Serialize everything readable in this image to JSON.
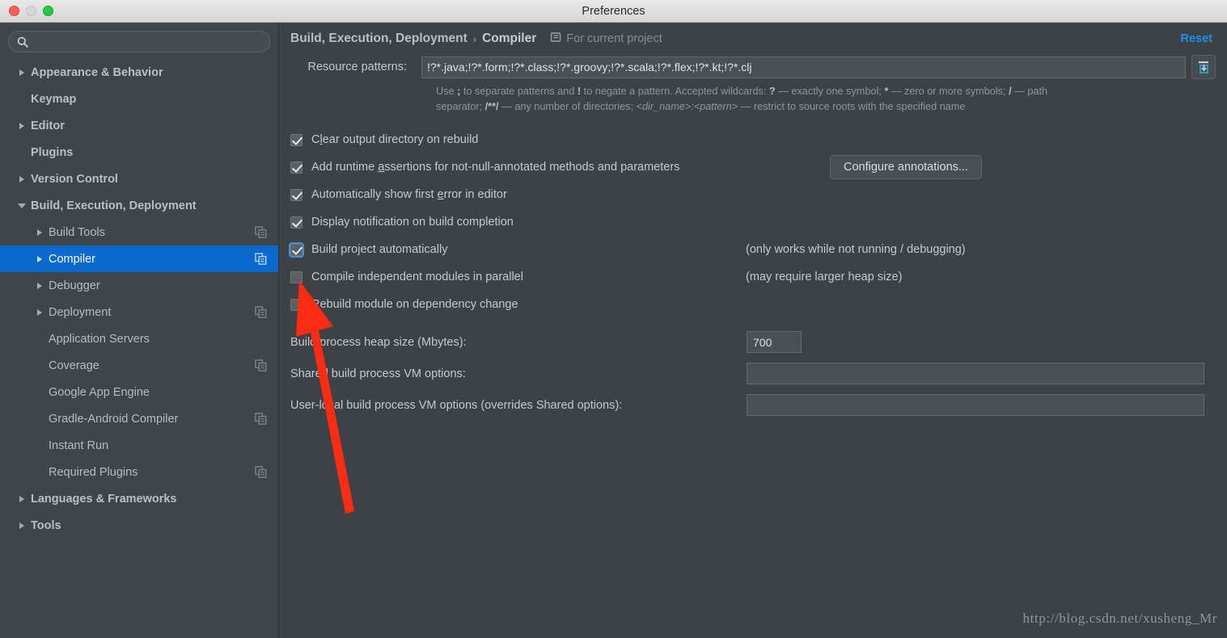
{
  "window": {
    "title": "Preferences",
    "traffic_lights": [
      "close-red",
      "minimize-gray",
      "zoom-green"
    ]
  },
  "sidebar": {
    "search": {
      "value": "",
      "placeholder": "",
      "icon": "search-icon"
    },
    "items": [
      {
        "label": "Appearance & Behavior",
        "level": 0,
        "toggle": "right",
        "selected": false,
        "copy_icon": false
      },
      {
        "label": "Keymap",
        "level": 0,
        "toggle": "none",
        "selected": false,
        "copy_icon": false
      },
      {
        "label": "Editor",
        "level": 0,
        "toggle": "right",
        "selected": false,
        "copy_icon": false
      },
      {
        "label": "Plugins",
        "level": 0,
        "toggle": "none",
        "selected": false,
        "copy_icon": false
      },
      {
        "label": "Version Control",
        "level": 0,
        "toggle": "right",
        "selected": false,
        "copy_icon": false
      },
      {
        "label": "Build, Execution, Deployment",
        "level": 0,
        "toggle": "down",
        "selected": false,
        "copy_icon": false
      },
      {
        "label": "Build Tools",
        "level": 1,
        "toggle": "right",
        "selected": false,
        "copy_icon": true
      },
      {
        "label": "Compiler",
        "level": 1,
        "toggle": "right",
        "selected": true,
        "copy_icon": true
      },
      {
        "label": "Debugger",
        "level": 1,
        "toggle": "right",
        "selected": false,
        "copy_icon": false
      },
      {
        "label": "Deployment",
        "level": 1,
        "toggle": "right",
        "selected": false,
        "copy_icon": true
      },
      {
        "label": "Application Servers",
        "level": 1,
        "toggle": "none",
        "selected": false,
        "copy_icon": false
      },
      {
        "label": "Coverage",
        "level": 1,
        "toggle": "none",
        "selected": false,
        "copy_icon": true
      },
      {
        "label": "Google App Engine",
        "level": 1,
        "toggle": "none",
        "selected": false,
        "copy_icon": false
      },
      {
        "label": "Gradle-Android Compiler",
        "level": 1,
        "toggle": "none",
        "selected": false,
        "copy_icon": true
      },
      {
        "label": "Instant Run",
        "level": 1,
        "toggle": "none",
        "selected": false,
        "copy_icon": false
      },
      {
        "label": "Required Plugins",
        "level": 1,
        "toggle": "none",
        "selected": false,
        "copy_icon": true
      },
      {
        "label": "Languages & Frameworks",
        "level": 0,
        "toggle": "right",
        "selected": false,
        "copy_icon": false
      },
      {
        "label": "Tools",
        "level": 0,
        "toggle": "right",
        "selected": false,
        "copy_icon": false
      }
    ]
  },
  "header": {
    "breadcrumb_root": "Build, Execution, Deployment",
    "breadcrumb_separator": "›",
    "breadcrumb_current": "Compiler",
    "scope_icon": "project-scope-icon",
    "scope_label": "For current project",
    "reset_label": "Reset",
    "reset_color": "#1b8ef2"
  },
  "main": {
    "resource_patterns": {
      "label": "Resource patterns:",
      "value": "!?*.java;!?*.form;!?*.class;!?*.groovy;!?*.scala;!?*.flex;!?*.kt;!?*.clj",
      "placeholder": "",
      "expand_button_icon": "insert-value-icon"
    },
    "hint_line_1_a": "Use ",
    "hint_line_1_semicolon": ";",
    "hint_line_1_b": " to separate patterns and ",
    "hint_line_1_bang": "!",
    "hint_line_1_c": " to negate a pattern. Accepted wildcards: ",
    "hint_line_1_q": "?",
    "hint_line_1_d": " — exactly one symbol; ",
    "hint_line_1_star": "*",
    "hint_line_1_e": " — zero or more symbols; ",
    "hint_line_1_slash": "/",
    "hint_line_1_f": " — path",
    "hint_line_2_a": "separator; ",
    "hint_line_2_globs": "/**/",
    "hint_line_2_b": " — any number of directories; ",
    "hint_line_2_dir": "<dir_name>:<pattern>",
    "hint_line_2_c": " — restrict to source roots with the specified name",
    "checkboxes": [
      {
        "label_pre": "C",
        "mnemonic": "l",
        "label_post": "ear output directory on rebuild",
        "checked": true,
        "focused": false,
        "note": ""
      },
      {
        "label_pre": "Add runtime ",
        "mnemonic": "a",
        "label_post": "ssertions for not-null-annotated methods and parameters",
        "checked": true,
        "focused": false,
        "note": "",
        "button": "Configure annotations..."
      },
      {
        "label_pre": "Automatically show first ",
        "mnemonic": "e",
        "label_post": "rror in editor",
        "checked": true,
        "focused": false,
        "note": ""
      },
      {
        "label_pre": "Display notification on build completion",
        "mnemonic": "",
        "label_post": "",
        "checked": true,
        "focused": false,
        "note": ""
      },
      {
        "label_pre": "Build project automatically",
        "mnemonic": "",
        "label_post": "",
        "checked": true,
        "focused": true,
        "note": "(only works while not running / debugging)"
      },
      {
        "label_pre": "Compile independent modules in parallel",
        "mnemonic": "",
        "label_post": "",
        "checked": false,
        "focused": false,
        "note": "(may require larger heap size)"
      },
      {
        "label_pre": "Rebuild module on dependency change",
        "mnemonic": "",
        "label_post": "",
        "checked": false,
        "focused": false,
        "note": ""
      }
    ],
    "fields": [
      {
        "label": "Build process heap size (Mbytes):",
        "value": "700",
        "placeholder": "",
        "width": "small"
      },
      {
        "label": "Shared build process VM options:",
        "value": "",
        "placeholder": "",
        "width": "wide"
      },
      {
        "label": "User-local build process VM options (overrides Shared options):",
        "value": "",
        "placeholder": "",
        "width": "wide"
      }
    ]
  },
  "annotation": {
    "type": "red-arrow",
    "color": "#fc2b13",
    "points_to": "compile-independent-modules-in-parallel-checkbox"
  },
  "watermark": {
    "text": "http://blog.csdn.net/xusheng_Mr"
  }
}
